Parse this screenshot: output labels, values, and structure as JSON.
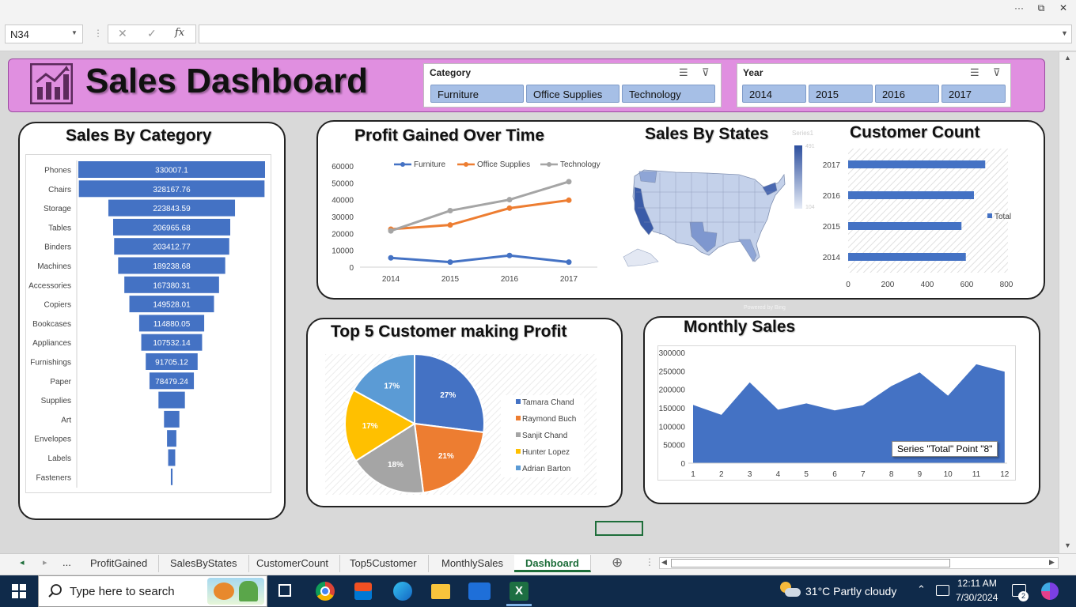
{
  "window": {
    "more": "···",
    "restore": "⧉",
    "close": "✕"
  },
  "formula_bar": {
    "name_box": "N34",
    "cancel": "✕",
    "enter": "✓",
    "fx": "fx",
    "formula": ""
  },
  "dashboard": {
    "title": "Sales Dashboard",
    "category_slicer": {
      "title": "Category",
      "items": [
        "Furniture",
        "Office Supplies",
        "Technology"
      ]
    },
    "year_slicer": {
      "title": "Year",
      "items": [
        "2014",
        "2015",
        "2016",
        "2017"
      ]
    }
  },
  "colors": {
    "header_band": "#e08fe0",
    "bar_blue": "#4472c4",
    "orange": "#ed7d31",
    "gray": "#a5a5a5",
    "gold": "#ffc000",
    "light_blue": "#5b9bd5"
  },
  "charts": {
    "sales_by_category": {
      "title": "Sales By Category"
    },
    "profit_over_time": {
      "title": "Profit Gained Over Time"
    },
    "sales_by_states": {
      "title": "Sales By States",
      "legend_title": "Series1",
      "legend_max": "491",
      "legend_min": "104",
      "credit": "Powered by Bing"
    },
    "customer_count": {
      "title": "Customer Count"
    },
    "top5": {
      "title": "Top 5 Customer making Profit"
    },
    "monthly": {
      "title": "Monthly Sales",
      "tooltip": "Series \"Total\" Point \"8\""
    }
  },
  "chart_data": [
    {
      "type": "bar",
      "title": "Sales By Category",
      "categories": [
        "Phones",
        "Chairs",
        "Storage",
        "Tables",
        "Binders",
        "Machines",
        "Accessories",
        "Copiers",
        "Bookcases",
        "Appliances",
        "Furnishings",
        "Paper",
        "Supplies",
        "Art",
        "Envelopes",
        "Labels",
        "Fasteners"
      ],
      "values": [
        330007.1,
        328167.76,
        223843.59,
        206965.68,
        203412.77,
        189238.68,
        167380.31,
        149528.01,
        114880.05,
        107532.14,
        91705.12,
        78479.24,
        46673.54,
        27118.79,
        16476.4,
        12486.31,
        3024.28
      ],
      "labels": [
        "330007.1",
        "328167.76",
        "223843.59",
        "206965.68",
        "203412.77",
        "189238.68",
        "167380.31",
        "149528.01",
        "114880.05",
        "107532.14",
        "91705.12",
        "78479.24",
        "",
        "",
        "",
        "",
        ""
      ]
    },
    {
      "type": "line",
      "title": "Profit Gained Over Time",
      "x": [
        "2014",
        "2015",
        "2016",
        "2017"
      ],
      "ylim": [
        0,
        60000
      ],
      "yticks": [
        "60000",
        "50000",
        "40000",
        "30000",
        "20000",
        "10000",
        "0"
      ],
      "series": [
        {
          "name": "Furniture",
          "values": [
            5500,
            3000,
            6900,
            3000
          ]
        },
        {
          "name": "Office Supplies",
          "values": [
            22500,
            25000,
            35000,
            39700
          ]
        },
        {
          "name": "Technology",
          "values": [
            21500,
            33500,
            40000,
            50700
          ]
        }
      ]
    },
    {
      "type": "bar",
      "title": "Customer Count",
      "categories": [
        "2017",
        "2016",
        "2015",
        "2014"
      ],
      "xlim": [
        0,
        800
      ],
      "xticks": [
        "0",
        "200",
        "400",
        "600",
        "800"
      ],
      "series": [
        {
          "name": "Total",
          "values": [
            693,
            636,
            573,
            595
          ]
        }
      ]
    },
    {
      "type": "pie",
      "title": "Top 5 Customer making Profit",
      "labels": [
        "Tamara Chand",
        "Raymond Buch",
        "Sanjit Chand",
        "Hunter Lopez",
        "Adrian Barton"
      ],
      "values": [
        27,
        21,
        18,
        17,
        17
      ],
      "value_labels": [
        "27%",
        "21%",
        "18%",
        "17%",
        "17%"
      ]
    },
    {
      "type": "area",
      "title": "Monthly Sales",
      "x": [
        "1",
        "2",
        "3",
        "4",
        "5",
        "6",
        "7",
        "8",
        "9",
        "10",
        "11",
        "12"
      ],
      "ylim": [
        0,
        300000
      ],
      "yticks": [
        "300000",
        "250000",
        "200000",
        "150000",
        "100000",
        "50000",
        "0"
      ],
      "series": [
        {
          "name": "Total",
          "values": [
            158000,
            131000,
            219000,
            145000,
            162000,
            143000,
            157000,
            209000,
            246000,
            183000,
            268000,
            248000
          ]
        }
      ]
    }
  ],
  "tabs": {
    "prev": "◂",
    "next": "▸",
    "more": "...",
    "items": [
      "ProfitGained",
      "SalesByStates",
      "CustomerCount",
      "Top5Customer",
      "MonthlySales",
      "Dashboard"
    ],
    "add": "⊕"
  },
  "taskbar": {
    "search_placeholder": "Type here to search",
    "weather": "31°C  Partly cloudy",
    "time": "12:11 AM",
    "date": "7/30/2024",
    "notif_count": "2"
  }
}
